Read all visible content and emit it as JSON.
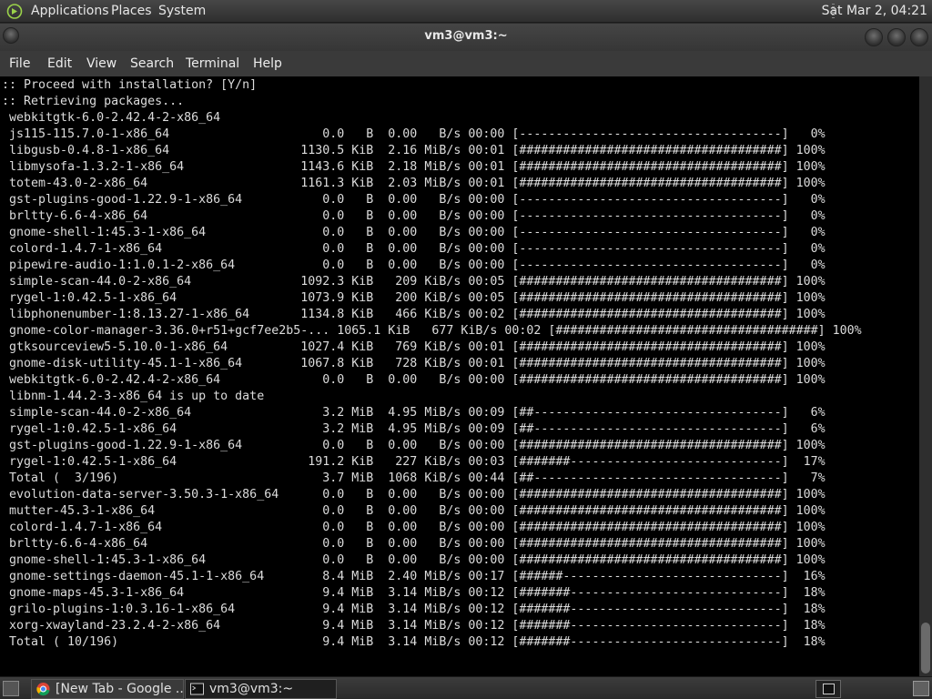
{
  "panel": {
    "menus": [
      "Applications",
      "Places",
      "System"
    ],
    "clock": "Sat Mar  2, 04:21"
  },
  "window": {
    "title": "vm3@vm3:~"
  },
  "menubar": [
    "File",
    "Edit",
    "View",
    "Search",
    "Terminal",
    "Help"
  ],
  "terminal": {
    "lines": [
      ":: Proceed with installation? [Y/n]",
      ":: Retrieving packages...",
      " webkitgtk-6.0-2.42.4-2-x86_64",
      " js115-115.7.0-1-x86_64                     0.0   B  0.00   B/s 00:00 [------------------------------------]   0%",
      " libgusb-0.4.8-1-x86_64                  1130.5 KiB  2.16 MiB/s 00:01 [####################################] 100%",
      " libmysofa-1.3.2-1-x86_64                1143.6 KiB  2.18 MiB/s 00:01 [####################################] 100%",
      " totem-43.0-2-x86_64                     1161.3 KiB  2.03 MiB/s 00:01 [####################################] 100%",
      " gst-plugins-good-1.22.9-1-x86_64           0.0   B  0.00   B/s 00:00 [------------------------------------]   0%",
      " brltty-6.6-4-x86_64                        0.0   B  0.00   B/s 00:00 [------------------------------------]   0%",
      " gnome-shell-1:45.3-1-x86_64                0.0   B  0.00   B/s 00:00 [------------------------------------]   0%",
      " colord-1.4.7-1-x86_64                      0.0   B  0.00   B/s 00:00 [------------------------------------]   0%",
      " pipewire-audio-1:1.0.1-2-x86_64            0.0   B  0.00   B/s 00:00 [------------------------------------]   0%",
      " simple-scan-44.0-2-x86_64               1092.3 KiB   209 KiB/s 00:05 [####################################] 100%",
      " rygel-1:0.42.5-1-x86_64                 1073.9 KiB   200 KiB/s 00:05 [####################################] 100%",
      " libphonenumber-1:8.13.27-1-x86_64       1134.8 KiB   466 KiB/s 00:02 [####################################] 100%",
      " gnome-color-manager-3.36.0+r51+gcf7ee2b5-... 1065.1 KiB   677 KiB/s 00:02 [####################################] 100%",
      " gtksourceview5-5.10.0-1-x86_64          1027.4 KiB   769 KiB/s 00:01 [####################################] 100%",
      " gnome-disk-utility-45.1-1-x86_64        1067.8 KiB   728 KiB/s 00:01 [####################################] 100%",
      " webkitgtk-6.0-2.42.4-2-x86_64              0.0   B  0.00   B/s 00:00 [####################################] 100%",
      " libnm-1.44.2-3-x86_64 is up to date",
      " simple-scan-44.0-2-x86_64                  3.2 MiB  4.95 MiB/s 00:09 [##----------------------------------]   6%",
      " rygel-1:0.42.5-1-x86_64                    3.2 MiB  4.95 MiB/s 00:09 [##----------------------------------]   6%",
      " gst-plugins-good-1.22.9-1-x86_64           0.0   B  0.00   B/s 00:00 [####################################] 100%",
      " rygel-1:0.42.5-1-x86_64                  191.2 KiB   227 KiB/s 00:03 [#######-----------------------------]  17%",
      " Total (  3/196)                            3.7 MiB  1068 KiB/s 00:44 [##----------------------------------]   7%",
      " evolution-data-server-3.50.3-1-x86_64      0.0   B  0.00   B/s 00:00 [####################################] 100%",
      " mutter-45.3-1-x86_64                       0.0   B  0.00   B/s 00:00 [####################################] 100%",
      " colord-1.4.7-1-x86_64                      0.0   B  0.00   B/s 00:00 [####################################] 100%",
      " brltty-6.6-4-x86_64                        0.0   B  0.00   B/s 00:00 [####################################] 100%",
      " gnome-shell-1:45.3-1-x86_64                0.0   B  0.00   B/s 00:00 [####################################] 100%",
      " gnome-settings-daemon-45.1-1-x86_64        8.4 MiB  2.40 MiB/s 00:17 [######------------------------------]  16%",
      " gnome-maps-45.3-1-x86_64                   9.4 MiB  3.14 MiB/s 00:12 [#######-----------------------------]  18%",
      " grilo-plugins-1:0.3.16-1-x86_64            9.4 MiB  3.14 MiB/s 00:12 [#######-----------------------------]  18%",
      " xorg-xwayland-23.2.4-2-x86_64              9.4 MiB  3.14 MiB/s 00:12 [#######-----------------------------]  18%",
      " Total ( 10/196)                            9.4 MiB  3.14 MiB/s 00:12 [#######-----------------------------]  18%"
    ]
  },
  "taskbar": {
    "tasks": [
      "[New Tab - Google ...",
      "vm3@vm3:~"
    ],
    "icons": [
      "show-desktop-icon",
      "chrome-icon",
      "terminal-icon"
    ]
  },
  "colors": {
    "terminal_bg": "#000000",
    "terminal_fg": "#dcdcdc",
    "panel": "#3a3a3a"
  }
}
